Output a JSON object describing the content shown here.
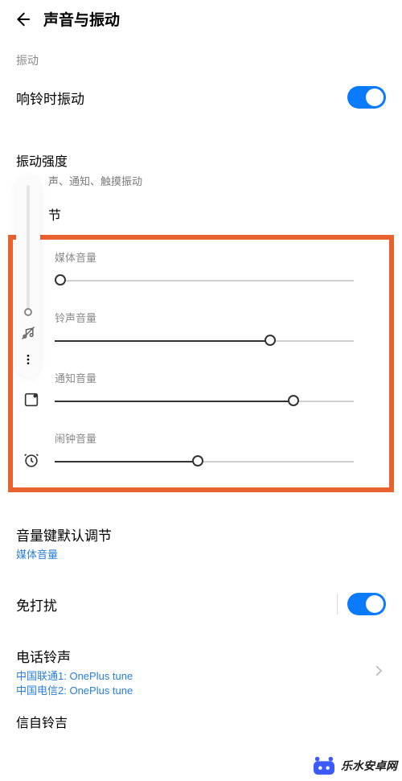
{
  "header": {
    "title": "声音与振动"
  },
  "vibrate_section_label": "振动",
  "vibrate_on_ring": {
    "label": "响铃时振动",
    "enabled": true
  },
  "vibration_strength": {
    "label": "振动强度",
    "sub_visible": "声、通知、触摸振动"
  },
  "volume_adjust": {
    "label_visible": "节"
  },
  "sliders": {
    "media": {
      "label": "媒体音量",
      "value_pct": 2
    },
    "ring": {
      "label": "铃声音量",
      "value_pct": 72
    },
    "notif": {
      "label": "通知音量",
      "value_pct": 80
    },
    "alarm": {
      "label": "闹钟音量",
      "value_pct": 48
    }
  },
  "vol_key_default": {
    "label": "音量键默认调节",
    "value": "媒体音量"
  },
  "dnd": {
    "label": "免打扰",
    "enabled": true
  },
  "phone_ring": {
    "label": "电话铃声",
    "line1": "中国联通1: OnePlus tune",
    "line2": "中国电信2: OnePlus tune"
  },
  "msg_ring": {
    "label_visible": "信自铃吉"
  },
  "float_bar": {
    "value_pct": 2
  },
  "watermark": "乐水安卓网",
  "colors": {
    "accent": "#0a7aff",
    "highlight": "#e8622f",
    "link": "#2a7fd6"
  }
}
